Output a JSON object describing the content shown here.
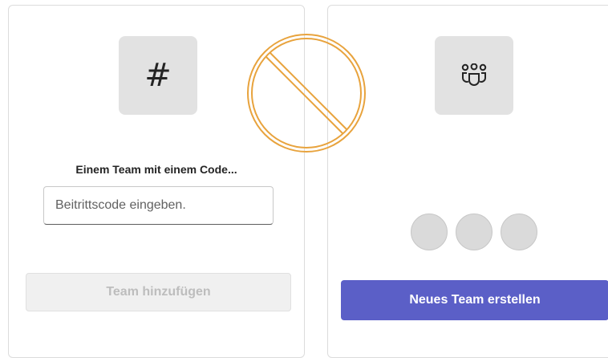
{
  "join_card": {
    "icon": "hash-icon",
    "title": "Einem Team mit einem Code...",
    "code_input_placeholder": "Beitrittscode eingeben.",
    "code_input_value": "",
    "add_button_label": "Team hinzufügen"
  },
  "create_card": {
    "icon": "people-team-icon",
    "create_button_label": "Neues Team erstellen"
  },
  "overlay": {
    "icon": "no-sign-icon",
    "color": "#e8a33d"
  },
  "colors": {
    "accent": "#5b5fc7",
    "disabled_button_bg": "#f0f0f0",
    "disabled_button_text": "#bdbdbd",
    "icon_tile_bg": "#e2e2e2",
    "placeholder_dot": "#dadada"
  }
}
